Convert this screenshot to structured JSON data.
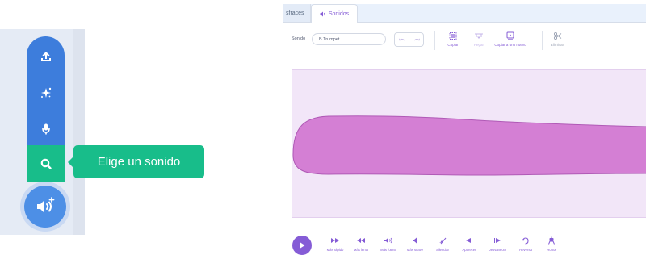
{
  "tooltip": {
    "text": "Elige un sonido"
  },
  "menu": {
    "items": [
      "upload-icon",
      "surprise-icon",
      "record-icon",
      "search-icon"
    ],
    "main_icon": "sound-plus-icon"
  },
  "colors": {
    "menu_blue": "#3d7ddc",
    "menu_active": "#18bd8a",
    "purple": "#855cd6",
    "wave_fill": "#d47fd4",
    "wave_bg": "#f2e6f8"
  },
  "tabs": {
    "costumes": "sfraces",
    "sounds": "Sonidos"
  },
  "toolbar": {
    "sound_label": "Sonido",
    "sound_name": "B Trumpet",
    "copy": "Copiar",
    "paste": "Pegar",
    "copy_to_new": "Copiar a uno nuevo",
    "delete": "Eliminar"
  },
  "effects": [
    {
      "label": "Más rápido",
      "icon": "faster-icon"
    },
    {
      "label": "Más lento",
      "icon": "slower-icon"
    },
    {
      "label": "Más fuerte",
      "icon": "louder-icon"
    },
    {
      "label": "Más suave",
      "icon": "softer-icon"
    },
    {
      "label": "Silenciar",
      "icon": "mute-icon"
    },
    {
      "label": "Aparecer",
      "icon": "fade-in-icon"
    },
    {
      "label": "Desvanecer",
      "icon": "fade-out-icon"
    },
    {
      "label": "Reversa",
      "icon": "reverse-icon"
    },
    {
      "label": "Robot",
      "icon": "robot-icon"
    }
  ]
}
